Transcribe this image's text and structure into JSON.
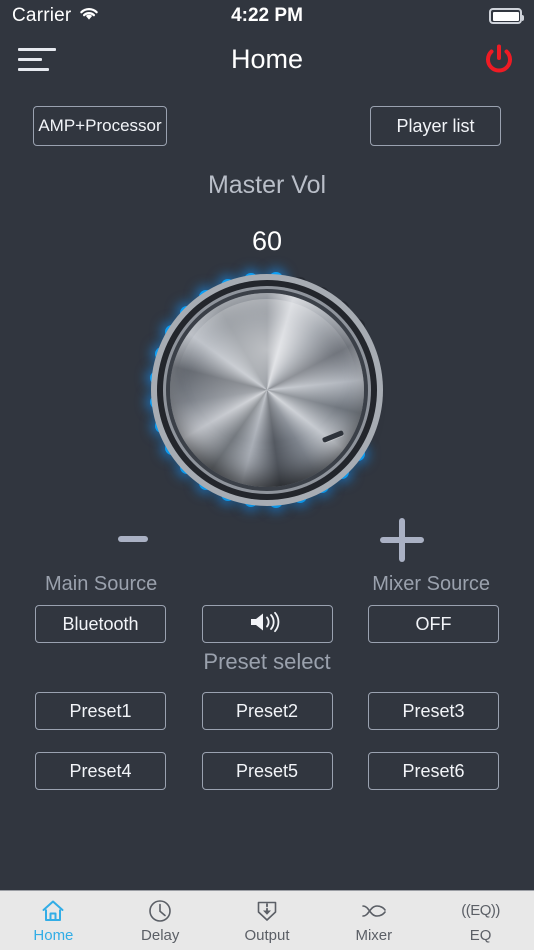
{
  "statusbar": {
    "carrier": "Carrier",
    "wifi_icon": "wifi-icon",
    "time": "4:22 PM",
    "battery_icon": "battery-full-icon"
  },
  "navbar": {
    "menu_icon": "hamburger-menu-icon",
    "title": "Home",
    "power_icon": "power-icon",
    "power_color": "#ef1b24"
  },
  "toolbar": {
    "amp_processor_label": "AMP+Processor",
    "player_list_label": "Player list"
  },
  "master_volume": {
    "label": "Master Vol",
    "value": "60",
    "minus_label": "minus-button",
    "plus_label": "plus-button",
    "leds_total": 24,
    "leds_on": 20,
    "led_on_color": "#0c9ff5",
    "led_off_color": "#262a32"
  },
  "sources": {
    "main_source_label": "Main Source",
    "main_source_value": "Bluetooth",
    "mixer_source_label": "Mixer Source",
    "mixer_source_value": "OFF",
    "speaker_icon": "speaker-volume-icon"
  },
  "presets": {
    "title": "Preset select",
    "items": [
      {
        "label": "Preset1"
      },
      {
        "label": "Preset2"
      },
      {
        "label": "Preset3"
      },
      {
        "label": "Preset4"
      },
      {
        "label": "Preset5"
      },
      {
        "label": "Preset6"
      }
    ]
  },
  "tabbar": {
    "active_color": "#32ade6",
    "inactive_color": "#5b5f66",
    "tabs": [
      {
        "label": "Home",
        "icon": "home-icon",
        "active": true
      },
      {
        "label": "Delay",
        "icon": "clock-icon",
        "active": false
      },
      {
        "label": "Output",
        "icon": "output-download-icon",
        "active": false
      },
      {
        "label": "Mixer",
        "icon": "shuffle-icon",
        "active": false
      },
      {
        "label": "EQ",
        "icon": "eq-icon",
        "active": false,
        "icon_text": "((EQ))"
      }
    ]
  }
}
